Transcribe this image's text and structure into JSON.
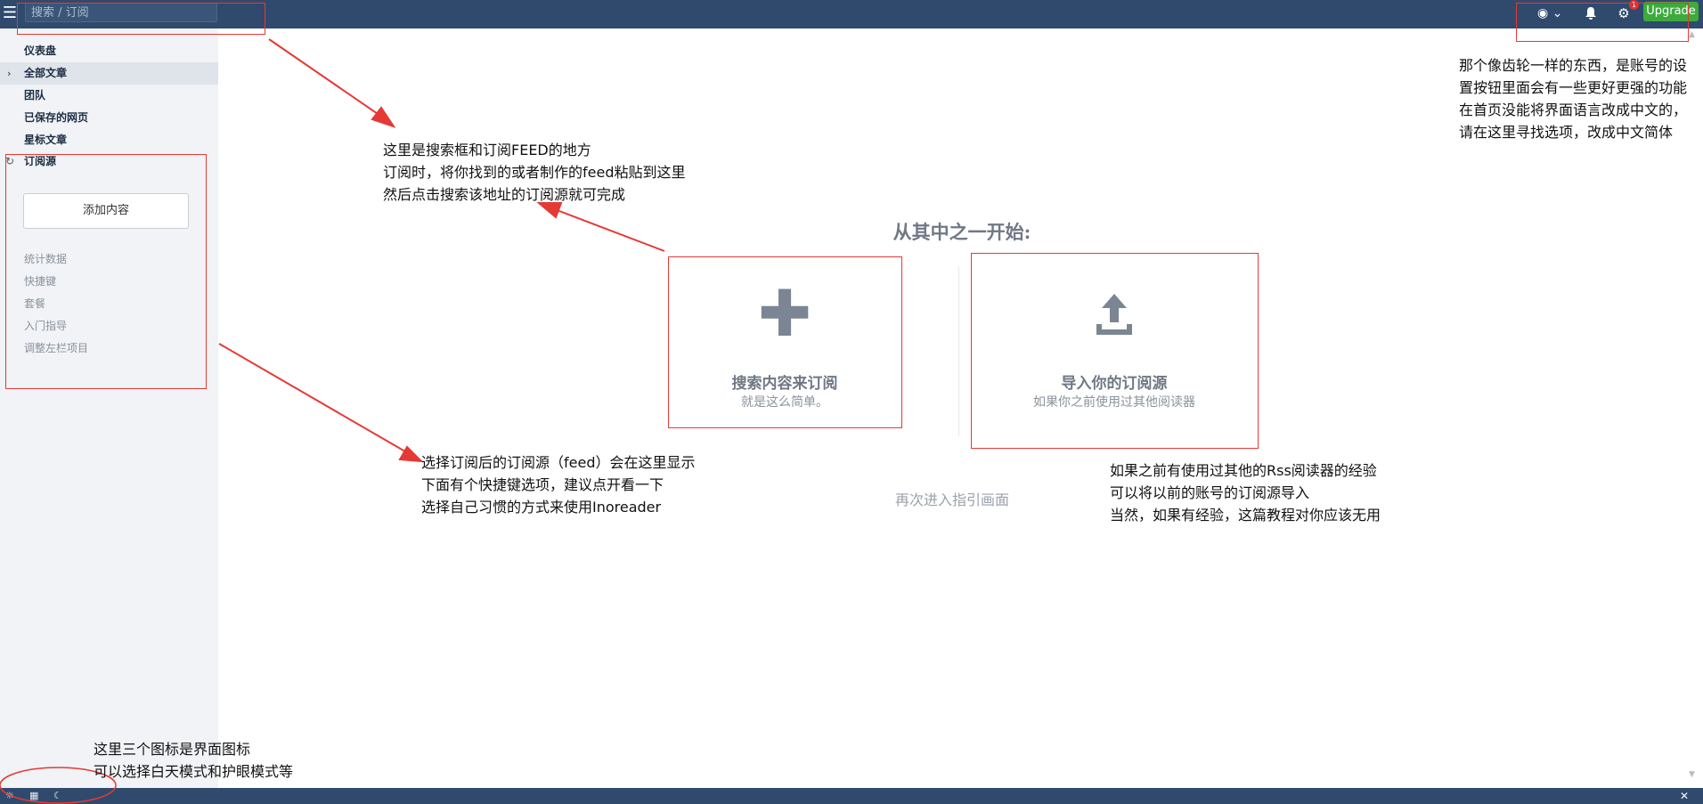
{
  "topbar": {
    "search_placeholder": "搜索 / 订阅",
    "upgrade_label": "Upgrade",
    "badge_count": "1",
    "icons": [
      "menu-icon",
      "eye-icon",
      "bell-icon",
      "gear-icon"
    ]
  },
  "sidebar": {
    "items": [
      {
        "label": "仪表盘"
      },
      {
        "label": "全部文章"
      },
      {
        "label": "团队"
      },
      {
        "label": "已保存的网页"
      },
      {
        "label": "星标文章"
      },
      {
        "label": "订阅源"
      }
    ],
    "add_label": "添加内容",
    "links": [
      "统计数据",
      "快捷键",
      "套餐",
      "入门指导",
      "调整左栏项目"
    ]
  },
  "main": {
    "start_title": "从其中之一开始:",
    "card_search": {
      "title": "搜索内容来订阅",
      "sub": "就是这么简单。"
    },
    "card_import": {
      "title": "导入你的订阅源",
      "sub": "如果你之前使用过其他阅读器"
    },
    "re_guide": "再次进入指引画面"
  },
  "annotations": {
    "search_note": [
      "这里是搜索框和订阅FEED的地方",
      "订阅时，将你找到的或者制作的feed粘贴到这里",
      "然后点击搜索该地址的订阅源就可完成"
    ],
    "settings_note": "那个像齿轮一样的东西，是账号的设置按钮里面会有一些更好更强的功能在首页没能将界面语言改成中文的，请在这里寻找选项，改成中文简体",
    "feed_note": [
      "选择订阅后的订阅源（feed）会在这里显示",
      "下面有个快捷键选项，建议点开看一下",
      "选择自己习惯的方式来使用Inoreader"
    ],
    "import_note": [
      "如果之前有使用过其他的Rss阅读器的经验",
      "可以将以前的账号的订阅源导入",
      "当然，如果有经验，这篇教程对你应该无用"
    ],
    "theme_note": [
      "这里三个图标是界面图标",
      "可以选择白天模式和护眼模式等"
    ]
  },
  "colors": {
    "topbar_bg": "#2f4a6d",
    "annotation_red": "#e53935",
    "upgrade_green": "#3cab3c"
  }
}
